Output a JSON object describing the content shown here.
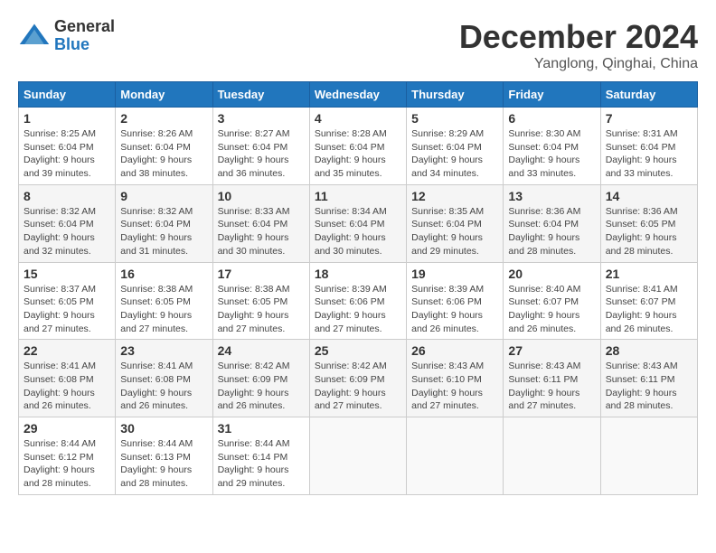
{
  "logo": {
    "general": "General",
    "blue": "Blue"
  },
  "title": {
    "month": "December 2024",
    "location": "Yanglong, Qinghai, China"
  },
  "weekdays": [
    "Sunday",
    "Monday",
    "Tuesday",
    "Wednesday",
    "Thursday",
    "Friday",
    "Saturday"
  ],
  "weeks": [
    [
      {
        "day": "1",
        "sunrise": "8:25 AM",
        "sunset": "6:04 PM",
        "daylight": "9 hours and 39 minutes."
      },
      {
        "day": "2",
        "sunrise": "8:26 AM",
        "sunset": "6:04 PM",
        "daylight": "9 hours and 38 minutes."
      },
      {
        "day": "3",
        "sunrise": "8:27 AM",
        "sunset": "6:04 PM",
        "daylight": "9 hours and 36 minutes."
      },
      {
        "day": "4",
        "sunrise": "8:28 AM",
        "sunset": "6:04 PM",
        "daylight": "9 hours and 35 minutes."
      },
      {
        "day": "5",
        "sunrise": "8:29 AM",
        "sunset": "6:04 PM",
        "daylight": "9 hours and 34 minutes."
      },
      {
        "day": "6",
        "sunrise": "8:30 AM",
        "sunset": "6:04 PM",
        "daylight": "9 hours and 33 minutes."
      },
      {
        "day": "7",
        "sunrise": "8:31 AM",
        "sunset": "6:04 PM",
        "daylight": "9 hours and 33 minutes."
      }
    ],
    [
      {
        "day": "8",
        "sunrise": "8:32 AM",
        "sunset": "6:04 PM",
        "daylight": "9 hours and 32 minutes."
      },
      {
        "day": "9",
        "sunrise": "8:32 AM",
        "sunset": "6:04 PM",
        "daylight": "9 hours and 31 minutes."
      },
      {
        "day": "10",
        "sunrise": "8:33 AM",
        "sunset": "6:04 PM",
        "daylight": "9 hours and 30 minutes."
      },
      {
        "day": "11",
        "sunrise": "8:34 AM",
        "sunset": "6:04 PM",
        "daylight": "9 hours and 30 minutes."
      },
      {
        "day": "12",
        "sunrise": "8:35 AM",
        "sunset": "6:04 PM",
        "daylight": "9 hours and 29 minutes."
      },
      {
        "day": "13",
        "sunrise": "8:36 AM",
        "sunset": "6:04 PM",
        "daylight": "9 hours and 28 minutes."
      },
      {
        "day": "14",
        "sunrise": "8:36 AM",
        "sunset": "6:05 PM",
        "daylight": "9 hours and 28 minutes."
      }
    ],
    [
      {
        "day": "15",
        "sunrise": "8:37 AM",
        "sunset": "6:05 PM",
        "daylight": "9 hours and 27 minutes."
      },
      {
        "day": "16",
        "sunrise": "8:38 AM",
        "sunset": "6:05 PM",
        "daylight": "9 hours and 27 minutes."
      },
      {
        "day": "17",
        "sunrise": "8:38 AM",
        "sunset": "6:05 PM",
        "daylight": "9 hours and 27 minutes."
      },
      {
        "day": "18",
        "sunrise": "8:39 AM",
        "sunset": "6:06 PM",
        "daylight": "9 hours and 27 minutes."
      },
      {
        "day": "19",
        "sunrise": "8:39 AM",
        "sunset": "6:06 PM",
        "daylight": "9 hours and 26 minutes."
      },
      {
        "day": "20",
        "sunrise": "8:40 AM",
        "sunset": "6:07 PM",
        "daylight": "9 hours and 26 minutes."
      },
      {
        "day": "21",
        "sunrise": "8:41 AM",
        "sunset": "6:07 PM",
        "daylight": "9 hours and 26 minutes."
      }
    ],
    [
      {
        "day": "22",
        "sunrise": "8:41 AM",
        "sunset": "6:08 PM",
        "daylight": "9 hours and 26 minutes."
      },
      {
        "day": "23",
        "sunrise": "8:41 AM",
        "sunset": "6:08 PM",
        "daylight": "9 hours and 26 minutes."
      },
      {
        "day": "24",
        "sunrise": "8:42 AM",
        "sunset": "6:09 PM",
        "daylight": "9 hours and 26 minutes."
      },
      {
        "day": "25",
        "sunrise": "8:42 AM",
        "sunset": "6:09 PM",
        "daylight": "9 hours and 27 minutes."
      },
      {
        "day": "26",
        "sunrise": "8:43 AM",
        "sunset": "6:10 PM",
        "daylight": "9 hours and 27 minutes."
      },
      {
        "day": "27",
        "sunrise": "8:43 AM",
        "sunset": "6:11 PM",
        "daylight": "9 hours and 27 minutes."
      },
      {
        "day": "28",
        "sunrise": "8:43 AM",
        "sunset": "6:11 PM",
        "daylight": "9 hours and 28 minutes."
      }
    ],
    [
      {
        "day": "29",
        "sunrise": "8:44 AM",
        "sunset": "6:12 PM",
        "daylight": "9 hours and 28 minutes."
      },
      {
        "day": "30",
        "sunrise": "8:44 AM",
        "sunset": "6:13 PM",
        "daylight": "9 hours and 28 minutes."
      },
      {
        "day": "31",
        "sunrise": "8:44 AM",
        "sunset": "6:14 PM",
        "daylight": "9 hours and 29 minutes."
      },
      null,
      null,
      null,
      null
    ]
  ]
}
